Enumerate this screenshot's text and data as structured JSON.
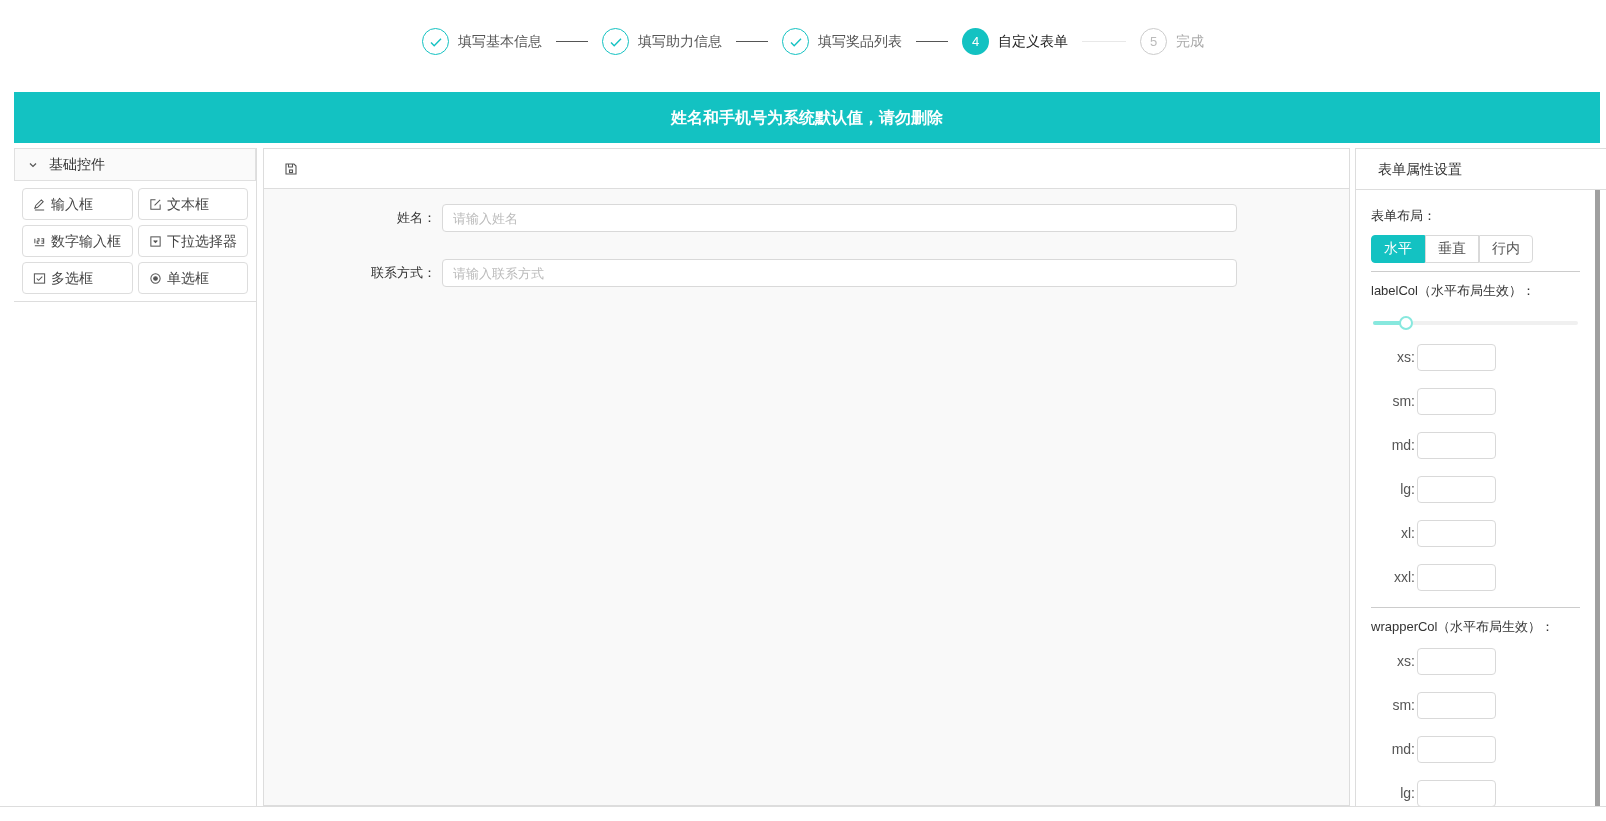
{
  "steps": [
    {
      "kind": "done",
      "label": "填写基本信息"
    },
    {
      "kind": "done",
      "label": "填写助力信息"
    },
    {
      "kind": "done",
      "label": "填写奖品列表"
    },
    {
      "kind": "active",
      "number": "4",
      "label": "自定义表单"
    },
    {
      "kind": "waiting",
      "number": "5",
      "label": "完成"
    }
  ],
  "banner": "姓名和手机号为系统默认值，请勿删除",
  "controls_panel": {
    "title": "基础控件",
    "expanded": true,
    "items": [
      {
        "kind": "input",
        "label": "输入框"
      },
      {
        "kind": "textarea",
        "label": "文本框"
      },
      {
        "kind": "number",
        "label": "数字输入框"
      },
      {
        "kind": "select",
        "label": "下拉选择器"
      },
      {
        "kind": "checkbox",
        "label": "多选框"
      },
      {
        "kind": "radio",
        "label": "单选框"
      }
    ]
  },
  "form": {
    "fields": [
      {
        "label": "姓名：",
        "placeholder": "请输入姓名"
      },
      {
        "label": "联系方式：",
        "placeholder": "请输入联系方式"
      }
    ]
  },
  "properties": {
    "title": "表单属性设置",
    "layout_label": "表单布局：",
    "layout_options": [
      {
        "label": "水平",
        "selected": true
      },
      {
        "label": "垂直",
        "selected": false
      },
      {
        "label": "行内",
        "selected": false
      }
    ],
    "groups": [
      {
        "title": "labelCol（水平布局生效）：",
        "slider": {
          "level": 0.16
        },
        "fields": [
          "xs:",
          "sm:",
          "md:",
          "lg:",
          "xl:",
          "xxl:"
        ]
      },
      {
        "title": "wrapperCol（水平布局生效）：",
        "fields": [
          "xs:",
          "sm:",
          "md:",
          "lg:"
        ]
      }
    ]
  }
}
